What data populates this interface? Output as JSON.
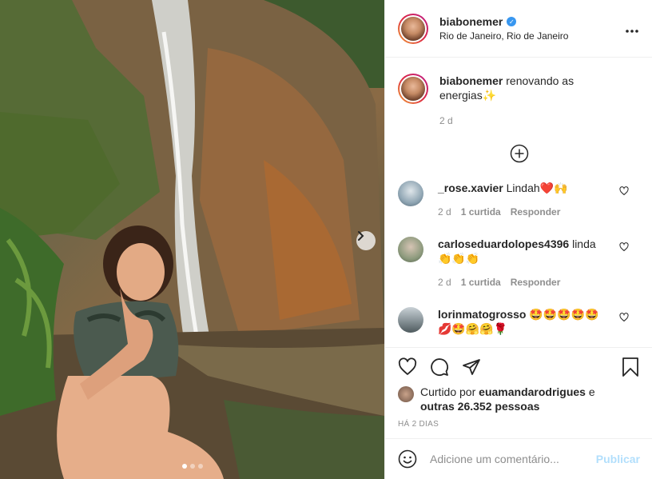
{
  "post": {
    "username": "biabonemer",
    "location": "Rio de Janeiro, Rio de Janeiro",
    "verified_icon": "verified-badge-icon",
    "more_icon": "more-horizontal-icon"
  },
  "caption": {
    "username": "biabonemer",
    "text": "renovando as energias✨",
    "time": "2 d"
  },
  "comments": [
    {
      "username": "_rose.xavier",
      "text": "Lindah❤️🙌",
      "time": "2 d",
      "likes": "1 curtida",
      "reply": "Responder"
    },
    {
      "username": "carloseduardolopes4396",
      "text": "linda👏👏👏",
      "time": "2 d",
      "likes": "1 curtida",
      "reply": "Responder"
    },
    {
      "username": "lorinmatogrosso",
      "text": "🤩🤩🤩🤩🤩💋🤩🤗🤗🌹",
      "time": "",
      "likes": "",
      "reply": ""
    }
  ],
  "actions": {
    "liked_by_prefix": "Curtido por",
    "liked_by_user": "euamandarodrigues",
    "liked_by_connector": "e",
    "others": "outras 26.352 pessoas",
    "ago": "HÁ 2 DIAS"
  },
  "add_comment": {
    "placeholder": "Adicione um comentário...",
    "publish": "Publicar"
  },
  "colors": {
    "verified": "#3897f0",
    "publish_disabled": "#b2dffc",
    "muted": "#8e8e8e"
  }
}
